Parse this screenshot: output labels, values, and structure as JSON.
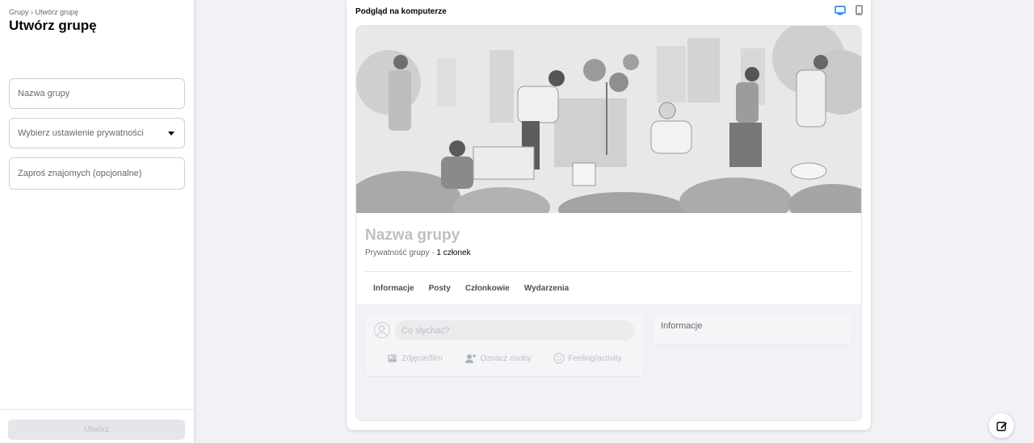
{
  "sidebar": {
    "breadcrumb_root": "Grupy",
    "breadcrumb_sep": "›",
    "breadcrumb_current": "Utwórz grupę",
    "title": "Utwórz grupę",
    "name_placeholder": "Nazwa grupy",
    "privacy_placeholder": "Wybierz ustawienie prywatności",
    "invite_placeholder": "Zaproś znajomych (opcjonalne)",
    "create_button": "Utwórz"
  },
  "preview": {
    "label": "Podgląd na komputerze",
    "desktop_icon": "desktop-icon",
    "mobile_icon": "mobile-icon",
    "group_name": "Nazwa grupy",
    "privacy": "Prywatność grupy · ",
    "members": "1 członek",
    "tabs": [
      "Informacje",
      "Posty",
      "Członkowie",
      "Wydarzenia"
    ],
    "composer_placeholder": "Co słychać?",
    "actions": [
      {
        "label": "Zdjęcie/film",
        "icon": "photo-icon"
      },
      {
        "label": "Oznacz osoby",
        "icon": "tag-people-icon"
      },
      {
        "label": "Feeling/activity",
        "icon": "smiley-icon"
      }
    ],
    "info_title": "Informacje"
  },
  "colors": {
    "accent": "#1877f2",
    "disabled": "#bcc0c4",
    "background": "#f0f2f5"
  }
}
